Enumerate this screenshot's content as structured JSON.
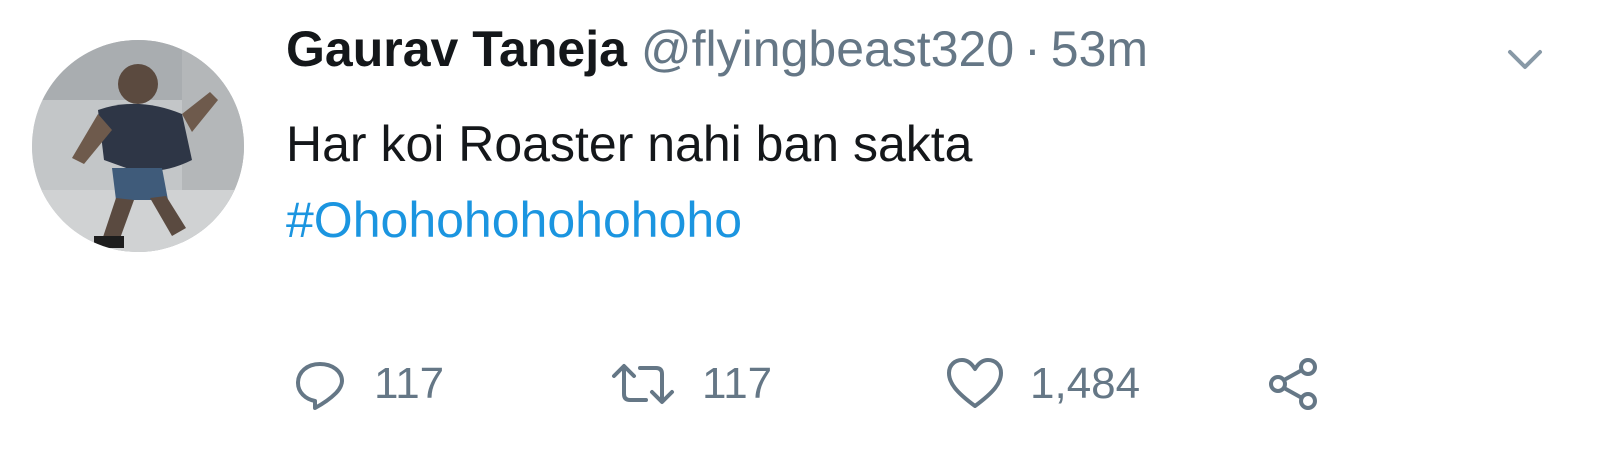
{
  "tweet": {
    "author": {
      "display_name": "Gaurav Taneja",
      "handle": "@flyingbeast320"
    },
    "separator": "·",
    "timestamp": "53m",
    "text": "Har koi Roaster nahi ban sakta",
    "hashtag": "#Ohohohohohohoho",
    "stats": {
      "replies": "117",
      "retweets": "117",
      "likes": "1,484"
    }
  },
  "icons": {
    "reply": "reply-icon",
    "retweet": "retweet-icon",
    "like": "heart-icon",
    "share": "share-icon",
    "menu": "chevron-down-icon"
  },
  "colors": {
    "text": "#14171a",
    "secondary": "#657786",
    "link": "#1b95e0"
  }
}
